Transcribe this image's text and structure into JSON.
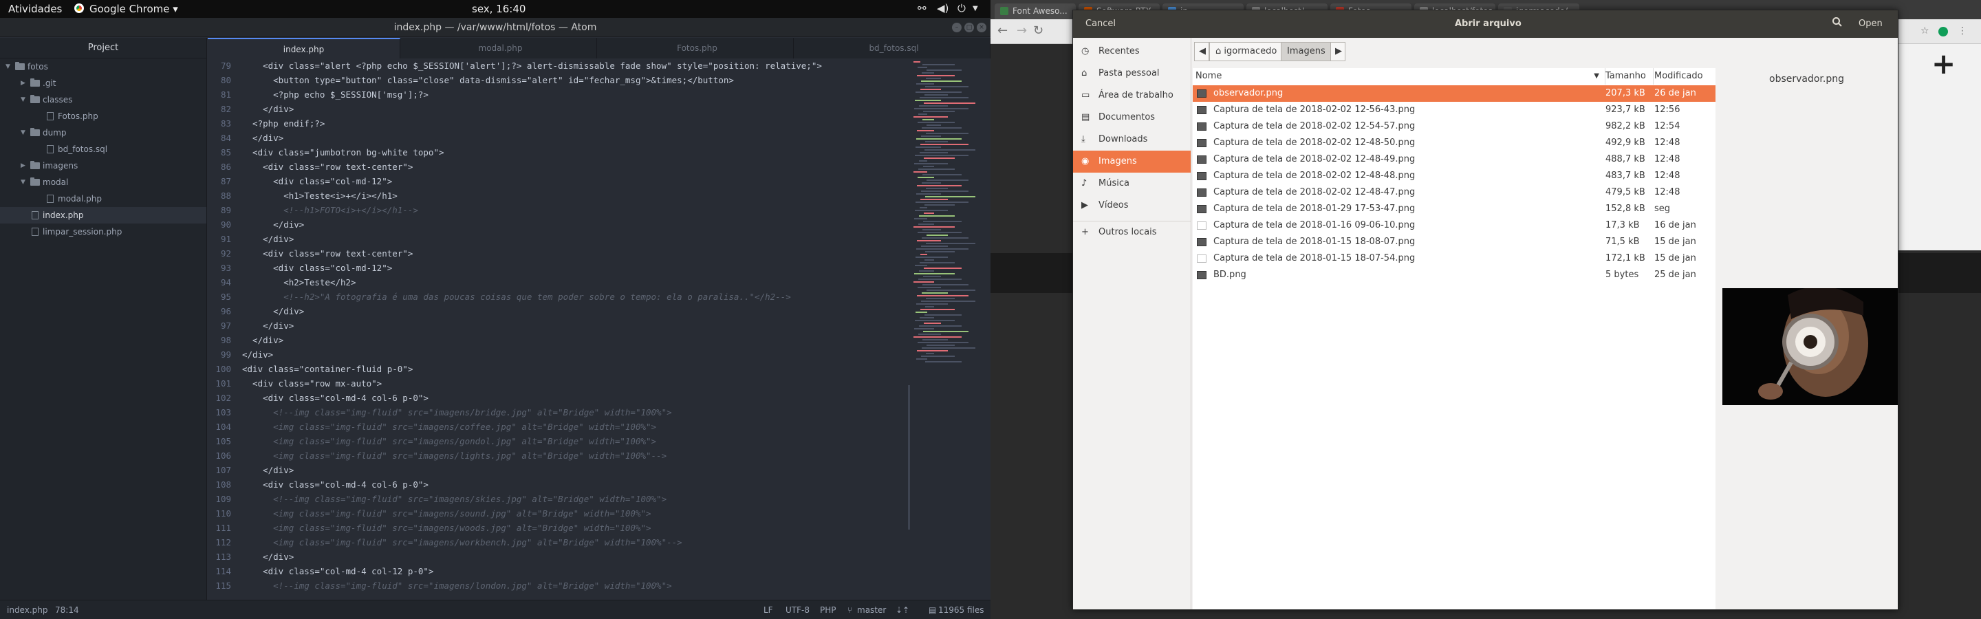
{
  "topbar": {
    "activities": "Atividades",
    "app_menu": "Google Chrome ▾",
    "clock": "sex, 16:40",
    "tray_icons": [
      "network-icon",
      "volume-icon",
      "power-icon",
      "chevron-down-icon"
    ]
  },
  "atom": {
    "window_title": "index.php — /var/www/html/fotos — Atom",
    "tree_header": "Project",
    "tree": [
      {
        "label": "fotos",
        "type": "folder",
        "depth": 0,
        "expanded": true
      },
      {
        "label": ".git",
        "type": "folder",
        "depth": 1,
        "expanded": false
      },
      {
        "label": "classes",
        "type": "folder",
        "depth": 1,
        "expanded": true
      },
      {
        "label": "Fotos.php",
        "type": "file",
        "depth": 2
      },
      {
        "label": "dump",
        "type": "folder",
        "depth": 1,
        "expanded": true
      },
      {
        "label": "bd_fotos.sql",
        "type": "file",
        "depth": 2
      },
      {
        "label": "imagens",
        "type": "folder",
        "depth": 1,
        "expanded": false
      },
      {
        "label": "modal",
        "type": "folder",
        "depth": 1,
        "expanded": true
      },
      {
        "label": "modal.php",
        "type": "file",
        "depth": 2
      },
      {
        "label": "index.php",
        "type": "file",
        "depth": 1,
        "selected": true
      },
      {
        "label": "limpar_session.php",
        "type": "file",
        "depth": 1
      }
    ],
    "tabs": [
      "index.php",
      "modal.php",
      "Fotos.php",
      "bd_fotos.sql"
    ],
    "active_tab": "index.php",
    "code": [
      {
        "n": "79",
        "text": "    <div class=\"alert <?php echo $_SESSION['alert'];?> alert-dismissable fade show\" style=\"position: relative;\">",
        "c": false
      },
      {
        "n": "80",
        "text": "      <button type=\"button\" class=\"close\" data-dismiss=\"alert\" id=\"fechar_msg\">&times;</button>",
        "c": false
      },
      {
        "n": "81",
        "text": "      <?php echo $_SESSION['msg'];?>",
        "c": false
      },
      {
        "n": "82",
        "text": "    </div>",
        "c": false
      },
      {
        "n": "83",
        "text": "  <?php endif;?>",
        "c": false
      },
      {
        "n": "84",
        "text": "  </div>",
        "c": false
      },
      {
        "n": "85",
        "text": "  <div class=\"jumbotron bg-white topo\">",
        "c": false
      },
      {
        "n": "86",
        "text": "    <div class=\"row text-center\">",
        "c": false
      },
      {
        "n": "87",
        "text": "      <div class=\"col-md-12\">",
        "c": false
      },
      {
        "n": "88",
        "text": "        <h1>Teste<i>+</i></h1>",
        "c": false
      },
      {
        "n": "89",
        "text": "        <!--h1>FOTO<i>+</i></h1-->",
        "c": true
      },
      {
        "n": "90",
        "text": "      </div>",
        "c": false
      },
      {
        "n": "91",
        "text": "    </div>",
        "c": false
      },
      {
        "n": "92",
        "text": "    <div class=\"row text-center\">",
        "c": false
      },
      {
        "n": "93",
        "text": "      <div class=\"col-md-12\">",
        "c": false
      },
      {
        "n": "94",
        "text": "        <h2>Teste</h2>",
        "c": false
      },
      {
        "n": "95",
        "text": "        <!--h2>\"A fotografia é uma das poucas coisas que tem poder sobre o tempo: ela o paralisa..\"</h2-->",
        "c": true
      },
      {
        "n": "96",
        "text": "      </div>",
        "c": false
      },
      {
        "n": "97",
        "text": "    </div>",
        "c": false
      },
      {
        "n": "98",
        "text": "  </div>",
        "c": false
      },
      {
        "n": "99",
        "text": "</div>",
        "c": false
      },
      {
        "n": "100",
        "text": "<div class=\"container-fluid p-0\">",
        "c": false
      },
      {
        "n": "101",
        "text": "  <div class=\"row mx-auto\">",
        "c": false
      },
      {
        "n": "102",
        "text": "    <div class=\"col-md-4 col-6 p-0\">",
        "c": false
      },
      {
        "n": "103",
        "text": "      <!--img class=\"img-fluid\" src=\"imagens/bridge.jpg\" alt=\"Bridge\" width=\"100%\">",
        "c": true
      },
      {
        "n": "104",
        "text": "      <img class=\"img-fluid\" src=\"imagens/coffee.jpg\" alt=\"Bridge\" width=\"100%\">",
        "c": true
      },
      {
        "n": "105",
        "text": "      <img class=\"img-fluid\" src=\"imagens/gondol.jpg\" alt=\"Bridge\" width=\"100%\">",
        "c": true
      },
      {
        "n": "106",
        "text": "      <img class=\"img-fluid\" src=\"imagens/lights.jpg\" alt=\"Bridge\" width=\"100%\"-->",
        "c": true
      },
      {
        "n": "107",
        "text": "    </div>",
        "c": false
      },
      {
        "n": "108",
        "text": "    <div class=\"col-md-4 col-6 p-0\">",
        "c": false
      },
      {
        "n": "109",
        "text": "      <!--img class=\"img-fluid\" src=\"imagens/skies.jpg\" alt=\"Bridge\" width=\"100%\">",
        "c": true
      },
      {
        "n": "110",
        "text": "      <img class=\"img-fluid\" src=\"imagens/sound.jpg\" alt=\"Bridge\" width=\"100%\">",
        "c": true
      },
      {
        "n": "111",
        "text": "      <img class=\"img-fluid\" src=\"imagens/woods.jpg\" alt=\"Bridge\" width=\"100%\">",
        "c": true
      },
      {
        "n": "112",
        "text": "      <img class=\"img-fluid\" src=\"imagens/workbench.jpg\" alt=\"Bridge\" width=\"100%\"-->",
        "c": true
      },
      {
        "n": "113",
        "text": "    </div>",
        "c": false
      },
      {
        "n": "114",
        "text": "    <div class=\"col-md-4 col-12 p-0\">",
        "c": false
      },
      {
        "n": "115",
        "text": "      <!--img class=\"img-fluid\" src=\"imagens/london.jpg\" alt=\"Bridge\" width=\"100%\">",
        "c": true
      }
    ],
    "status": {
      "file": "index.php",
      "cursor": "78:14",
      "line_ending": "LF",
      "encoding": "UTF-8",
      "grammar": "PHP",
      "branch": "master",
      "files": "11965 files"
    }
  },
  "chrome": {
    "tabs": [
      "Font Aweso...",
      "Software RTX",
      "in...",
      "localhost/...",
      "Fotos",
      "localhost/fotos",
      "igormacedo/..."
    ]
  },
  "dialog": {
    "title": "Abrir arquivo",
    "cancel": "Cancel",
    "open": "Open",
    "places": [
      {
        "label": "Recentes",
        "icon": "clock-icon"
      },
      {
        "label": "Pasta pessoal",
        "icon": "home-icon"
      },
      {
        "label": "Área de trabalho",
        "icon": "desktop-icon"
      },
      {
        "label": "Documentos",
        "icon": "document-icon"
      },
      {
        "label": "Downloads",
        "icon": "download-icon"
      },
      {
        "label": "Imagens",
        "icon": "camera-icon",
        "selected": true
      },
      {
        "label": "Música",
        "icon": "music-icon"
      },
      {
        "label": "Vídeos",
        "icon": "video-icon"
      },
      {
        "label": "Outros locais",
        "icon": "plus-icon"
      }
    ],
    "path": [
      "igormacedo",
      "Imagens"
    ],
    "columns": {
      "name": "Nome",
      "size": "Tamanho",
      "modified": "Modificado"
    },
    "files": [
      {
        "name": "observador.png",
        "size": "207,3 kB",
        "modified": "26 de jan",
        "selected": true,
        "thumb": true
      },
      {
        "name": "Captura de tela de 2018-02-02 12-56-43.png",
        "size": "923,7 kB",
        "modified": "12:56",
        "thumb": true
      },
      {
        "name": "Captura de tela de 2018-02-02 12-54-57.png",
        "size": "982,2 kB",
        "modified": "12:54",
        "thumb": true
      },
      {
        "name": "Captura de tela de 2018-02-02 12-48-50.png",
        "size": "492,9 kB",
        "modified": "12:48",
        "thumb": true
      },
      {
        "name": "Captura de tela de 2018-02-02 12-48-49.png",
        "size": "488,7 kB",
        "modified": "12:48",
        "thumb": true
      },
      {
        "name": "Captura de tela de 2018-02-02 12-48-48.png",
        "size": "483,7 kB",
        "modified": "12:48",
        "thumb": true
      },
      {
        "name": "Captura de tela de 2018-02-02 12-48-47.png",
        "size": "479,5 kB",
        "modified": "12:48",
        "thumb": true
      },
      {
        "name": "Captura de tela de 2018-01-29 17-53-47.png",
        "size": "152,8 kB",
        "modified": "seg",
        "thumb": true
      },
      {
        "name": "Captura de tela de 2018-01-16 09-06-10.png",
        "size": "17,3 kB",
        "modified": "16 de jan",
        "thumb": false
      },
      {
        "name": "Captura de tela de 2018-01-15 18-08-07.png",
        "size": "71,5 kB",
        "modified": "15 de jan",
        "thumb": true
      },
      {
        "name": "Captura de tela de 2018-01-15 18-07-54.png",
        "size": "172,1 kB",
        "modified": "15 de jan",
        "thumb": false
      },
      {
        "name": "BD.png",
        "size": "5 bytes",
        "modified": "25 de jan",
        "thumb": true
      }
    ],
    "preview_name": "observador.png"
  },
  "colors": {
    "accent": "#f07746",
    "atom_bg": "#282c34",
    "atom_tab_accent": "#568af2"
  }
}
